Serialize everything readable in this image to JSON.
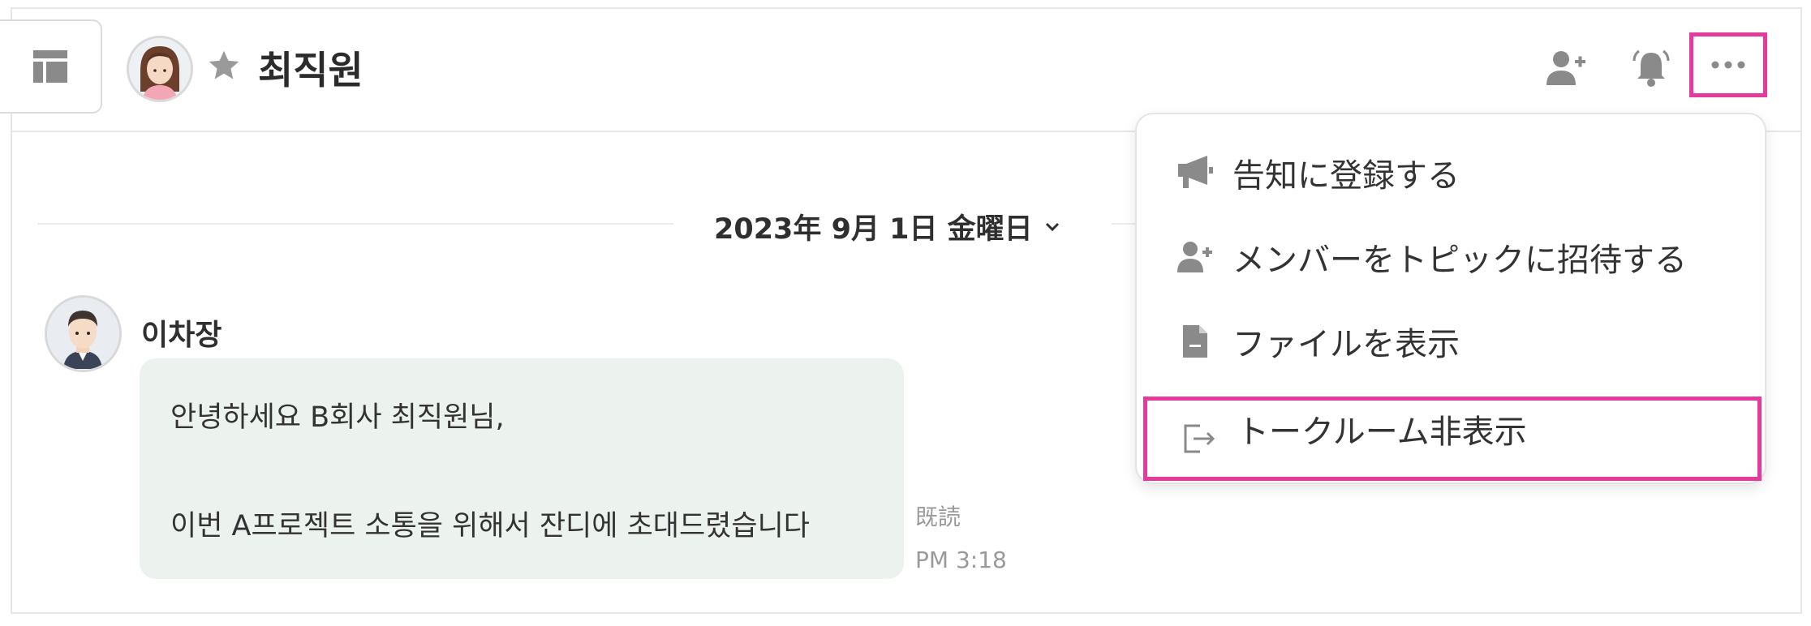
{
  "header": {
    "title": "최직원",
    "icons": {
      "sidebar_toggle": "sidebar-layout-icon",
      "favorite": "star-icon",
      "add_member": "add-user-icon",
      "notifications": "bell-icon",
      "more": "more-horizontal-icon"
    }
  },
  "conversation": {
    "date_label": "2023年 9月 1日 金曜日",
    "messages": [
      {
        "sender": "이차장",
        "lines": [
          "안녕하세요 B회사 최직원님,",
          "이번 A프로젝트 소통을 위해서 잔디에 초대드렸습니다"
        ],
        "read_label": "既読",
        "time": "PM 3:18"
      }
    ]
  },
  "menu": {
    "items": [
      {
        "label": "告知に登録する",
        "icon": "megaphone-icon"
      },
      {
        "label": "メンバーをトピックに招待する",
        "icon": "add-user-icon"
      },
      {
        "label": "ファイルを表示",
        "icon": "file-icon"
      },
      {
        "label": "トークルーム非表示",
        "icon": "exit-icon",
        "highlighted": true
      }
    ]
  },
  "colors": {
    "highlight": "#e5399b",
    "bubble": "#ecf3ef",
    "icon": "#8a8a8a"
  }
}
